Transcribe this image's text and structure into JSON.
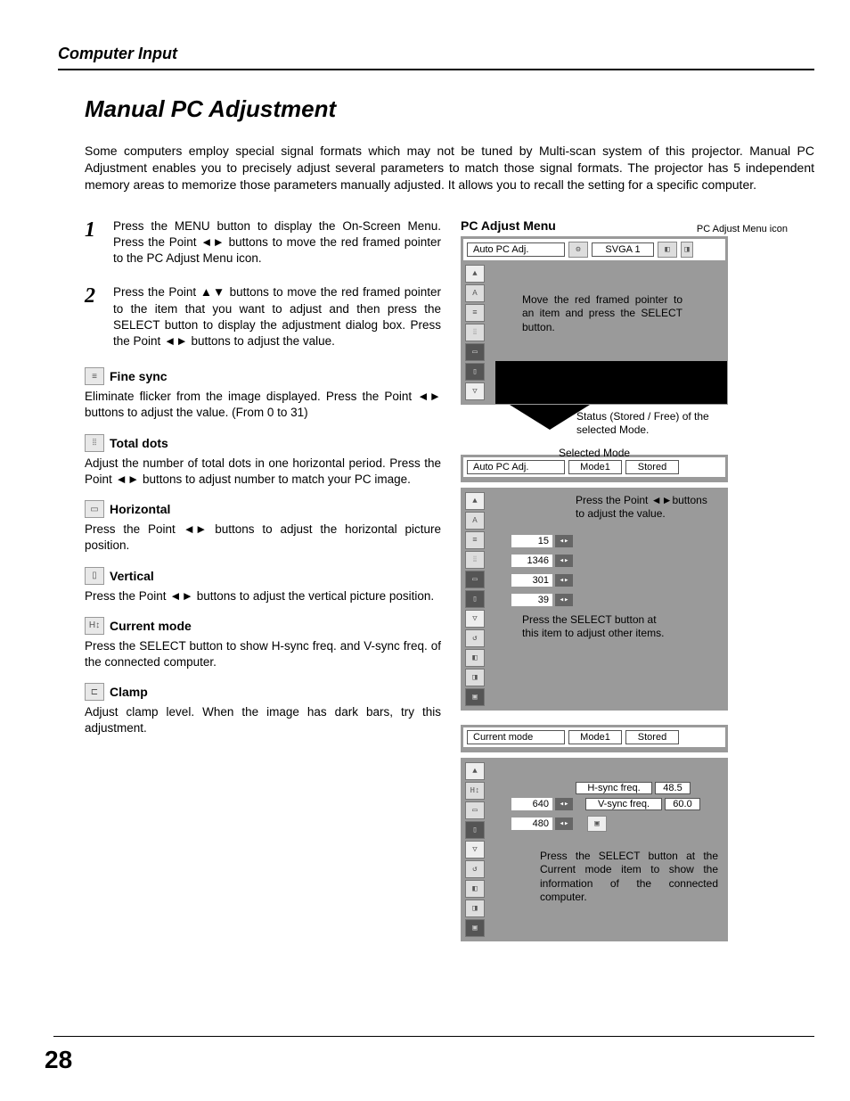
{
  "page": {
    "section_header": "Computer Input",
    "title": "Manual PC Adjustment",
    "intro": "Some computers employ special signal formats which may not be tuned by Multi-scan system of this projector. Manual PC Adjustment enables you to precisely adjust several parameters to match those signal formats.  The projector has 5 independent memory areas to memorize those parameters manually adjusted.  It allows you to recall the setting for a specific computer.",
    "page_number": "28"
  },
  "steps": {
    "s1_num": "1",
    "s1_text": "Press the MENU button to display the On-Screen Menu.  Press the Point ◄► buttons to move the red framed pointer to the PC Adjust Menu icon.",
    "s2_num": "2",
    "s2_text": "Press the Point ▲▼ buttons to move the red framed pointer to the item that you want to adjust and then press the SELECT button to display the adjustment dialog box.  Press the Point ◄► buttons to adjust the value."
  },
  "subsections": {
    "fine_sync": {
      "title": "Fine sync",
      "text": "Eliminate flicker from the image displayed.  Press the Point ◄► buttons to adjust the value.  (From 0 to 31)"
    },
    "total_dots": {
      "title": "Total dots",
      "text": "Adjust the number of total dots in one horizontal period.  Press the Point ◄► buttons to  adjust number to match your PC image."
    },
    "horizontal": {
      "title": "Horizontal",
      "text": "Press the Point ◄► buttons to adjust the horizontal picture position."
    },
    "vertical": {
      "title": "Vertical",
      "text": "Press the Point ◄► buttons to adjust the vertical picture position."
    },
    "current_mode": {
      "title": "Current mode",
      "text": "Press the SELECT button to show H-sync freq. and V-sync freq. of the connected computer."
    },
    "clamp": {
      "title": "Clamp",
      "text": "Adjust clamp level.  When the image has dark bars, try this adjustment."
    }
  },
  "figure": {
    "icon_label": "PC Adjust Menu icon",
    "menu_title": "PC Adjust Menu",
    "top_menu_item": "Auto PC Adj.",
    "svga_label": "SVGA 1",
    "cap_move_pointer": "Move the red framed pointer to an item and press the SELECT button.",
    "cap_status": "Status (Stored / Free) of the selected Mode.",
    "cap_selected_mode": "Selected Mode",
    "cap_press_point": "Press the Point ◄►buttons to adjust the value.",
    "cap_press_select_other": "Press the SELECT button at this item to adjust other items.",
    "cap_press_select_current": "Press the SELECT button at the Current mode item to show the information of the connected computer.",
    "mid_bar": {
      "label": "Auto PC Adj.",
      "mode": "Mode1",
      "status": "Stored"
    },
    "values": {
      "v1": "15",
      "v2": "1346",
      "v3": "301",
      "v4": "39"
    },
    "current_bar": {
      "label": "Current mode",
      "mode": "Mode1",
      "status": "Stored"
    },
    "current_values": {
      "w": "640",
      "h": "480"
    },
    "sync": {
      "h_label": "H-sync freq.",
      "h_val": "48.5",
      "v_label": "V-sync freq.",
      "v_val": "60.0"
    }
  }
}
